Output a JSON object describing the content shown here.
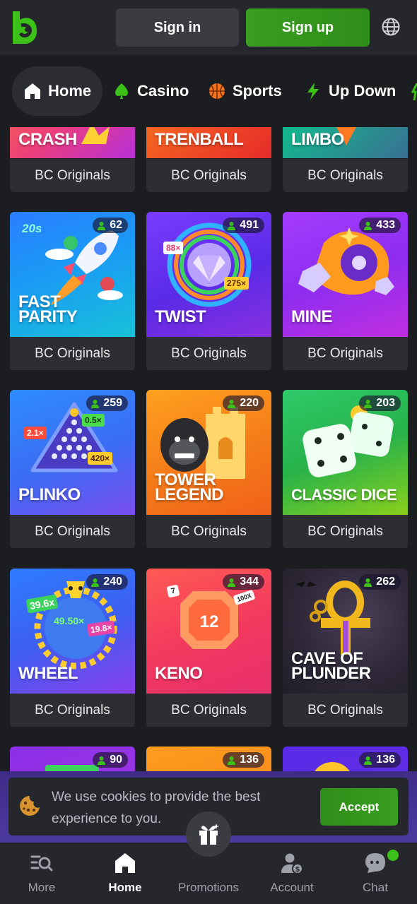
{
  "header": {
    "signin_label": "Sign in",
    "signup_label": "Sign up",
    "brand_color": "#3bc117"
  },
  "nav_tabs": [
    {
      "label": "Home",
      "icon": "home-icon",
      "active": true
    },
    {
      "label": "Casino",
      "icon": "spade-icon",
      "active": false
    },
    {
      "label": "Sports",
      "icon": "basketball-icon",
      "active": false
    },
    {
      "label": "Up Down",
      "icon": "lightning-icon",
      "active": false
    }
  ],
  "games": [
    {
      "title": "CRASH",
      "provider": "BC Originals",
      "players": ""
    },
    {
      "title": "TRENBALL",
      "provider": "BC Originals",
      "players": ""
    },
    {
      "title": "LIMBO",
      "provider": "BC Originals",
      "players": ""
    },
    {
      "title": "FAST\nPARITY",
      "provider": "BC Originals",
      "players": "62"
    },
    {
      "title": "TWIST",
      "provider": "BC Originals",
      "players": "491"
    },
    {
      "title": "MINE",
      "provider": "BC Originals",
      "players": "433"
    },
    {
      "title": "PLINKO",
      "provider": "BC Originals",
      "players": "259"
    },
    {
      "title": "TOWER\nLEGEND",
      "provider": "BC Originals",
      "players": "220"
    },
    {
      "title": "CLASSIC DICE",
      "provider": "BC Originals",
      "players": "203"
    },
    {
      "title": "WHEEL",
      "provider": "BC Originals",
      "players": "240"
    },
    {
      "title": "KENO",
      "provider": "BC Originals",
      "players": "344"
    },
    {
      "title": "CAVE OF\nPLUNDER",
      "provider": "BC Originals",
      "players": "262"
    },
    {
      "title": "",
      "provider": "",
      "players": "90"
    },
    {
      "title": "",
      "provider": "",
      "players": "136"
    },
    {
      "title": "",
      "provider": "",
      "players": "136"
    }
  ],
  "art_labels": {
    "fast_parity_timer": "20s",
    "twist_mult_a": "88×",
    "twist_mult_b": "275×",
    "plinko_mult_a": "2.1×",
    "plinko_mult_b": "0.5×",
    "plinko_mult_c": "420×",
    "wheel_mult_a": "39.6x",
    "wheel_mult_b": "49.50×",
    "wheel_mult_c": "19.8×",
    "keno_number": "12",
    "keno_chip_a": "7",
    "keno_chip_b": "100X"
  },
  "cookie": {
    "text": "We use cookies to provide the best experience to you.",
    "accept_label": "Accept"
  },
  "bottom_nav": [
    {
      "label": "More",
      "icon": "search-list-icon"
    },
    {
      "label": "Home",
      "icon": "home-icon",
      "active": true
    },
    {
      "label": "Promotions",
      "icon": "gift-icon"
    },
    {
      "label": "Account",
      "icon": "account-icon"
    },
    {
      "label": "Chat",
      "icon": "chat-icon"
    }
  ]
}
